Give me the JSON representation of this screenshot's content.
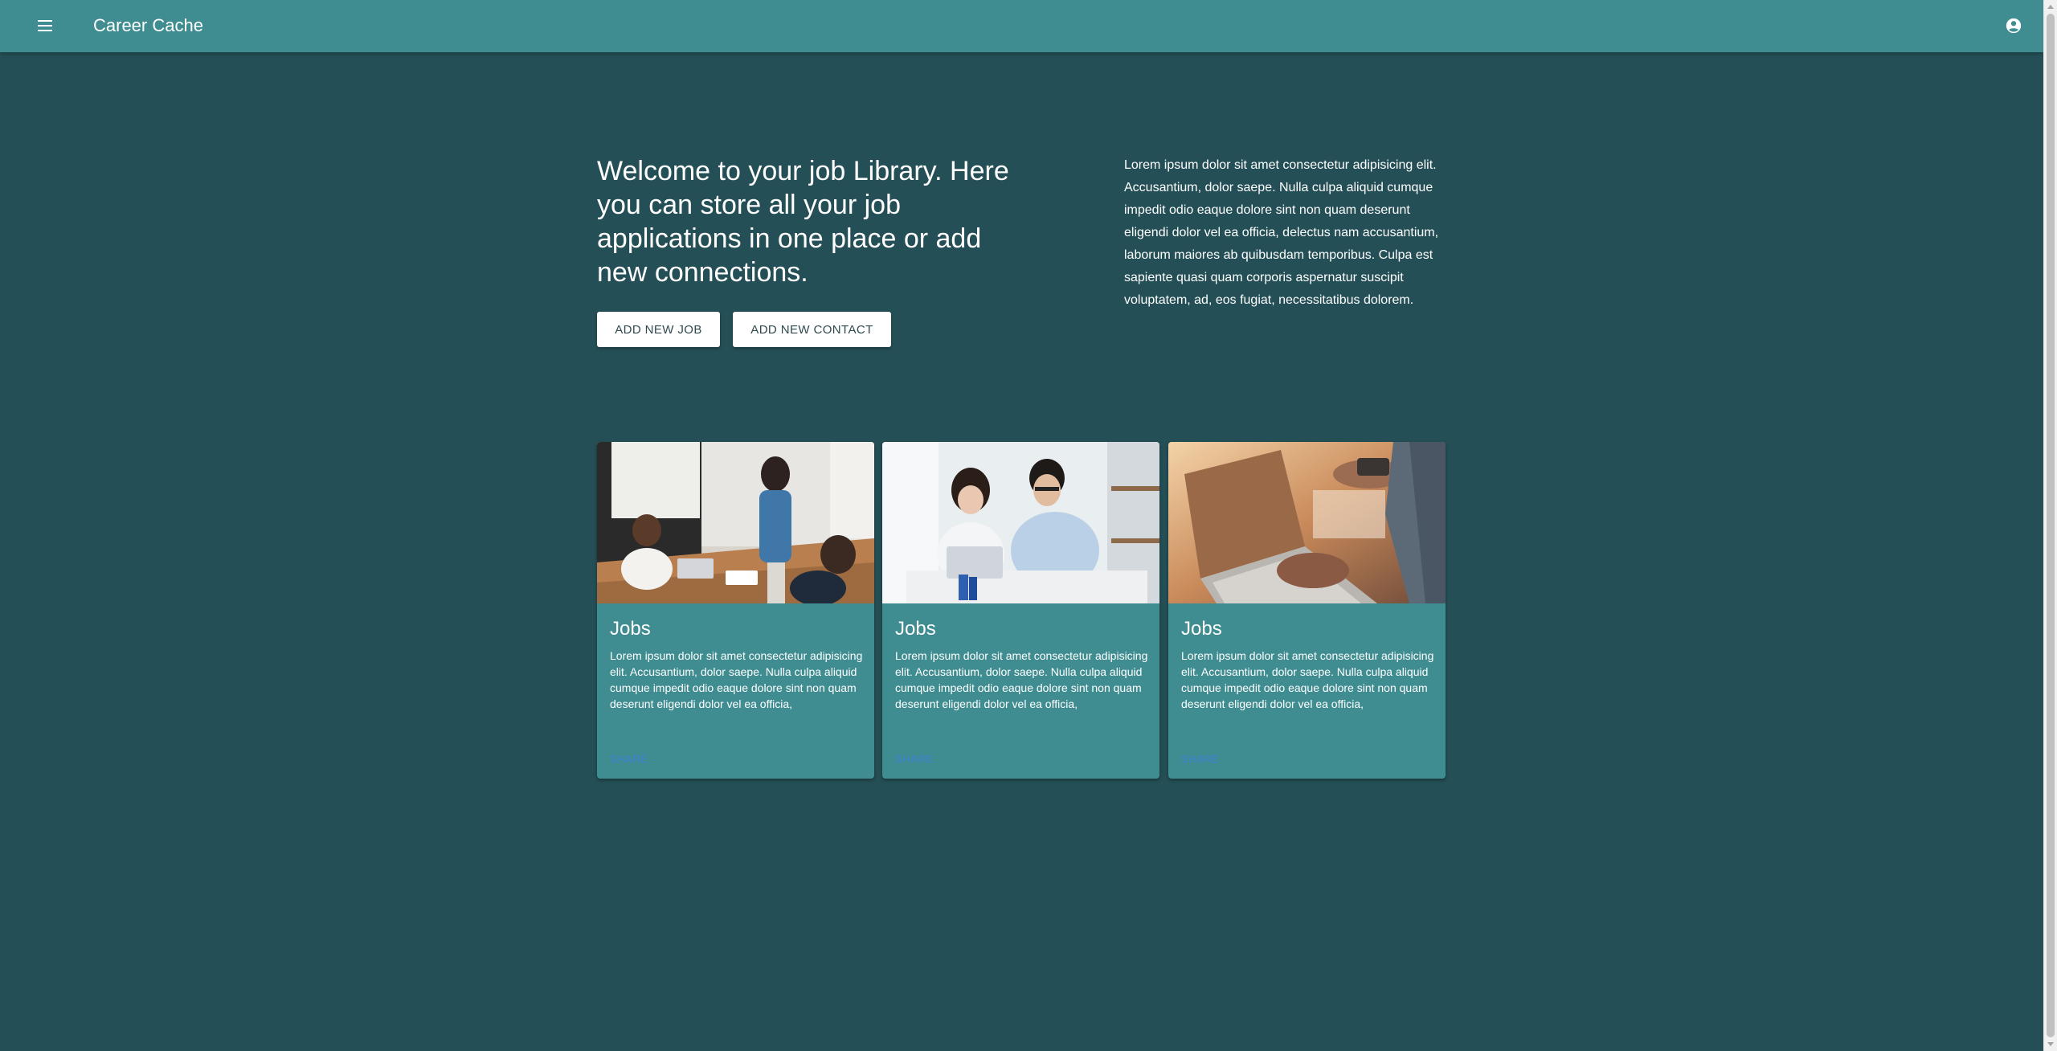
{
  "appbar": {
    "title": "Career Cache",
    "menu_icon": "menu-icon",
    "account_icon": "account-circle-icon",
    "color": "#3f8c91"
  },
  "hero": {
    "heading": "Welcome to your job Library. Here you can store all your job applications in one place or add new connections.",
    "add_job_label": "ADD NEW JOB",
    "add_contact_label": "ADD NEW CONTACT",
    "description": "Lorem ipsum dolor sit amet consectetur adipisicing elit. Accusantium, dolor saepe. Nulla culpa aliquid cumque impedit odio eaque dolore sint non quam deserunt eligendi dolor vel ea officia, delectus nam accusantium, laborum maiores ab quibusdam temporibus. Culpa est sapiente quasi quam corporis aspernatur suscipit voluptatem, ad, eos fugiat, necessitatibus dolorem."
  },
  "cards": [
    {
      "title": "Jobs",
      "body": "Lorem ipsum dolor sit amet consectetur adipisicing elit. Accusantium, dolor saepe. Nulla culpa aliquid cumque impedit odio eaque dolore sint non quam deserunt eligendi dolor vel ea officia,",
      "action": "SHARE",
      "image": "team-meeting-photo"
    },
    {
      "title": "Jobs",
      "body": "Lorem ipsum dolor sit amet consectetur adipisicing elit. Accusantium, dolor saepe. Nulla culpa aliquid cumque impedit odio eaque dolore sint non quam deserunt eligendi dolor vel ea officia,",
      "action": "SHARE",
      "image": "office-colleagues-photo"
    },
    {
      "title": "Jobs",
      "body": "Lorem ipsum dolor sit amet consectetur adipisicing elit. Accusantium, dolor saepe. Nulla culpa aliquid cumque impedit odio eaque dolore sint non quam deserunt eligendi dolor vel ea officia,",
      "action": "SHARE",
      "image": "laptop-phone-photo"
    }
  ],
  "theme": {
    "background": "#244f56",
    "surface": "#3f8c91",
    "link": "#3b82d6"
  }
}
